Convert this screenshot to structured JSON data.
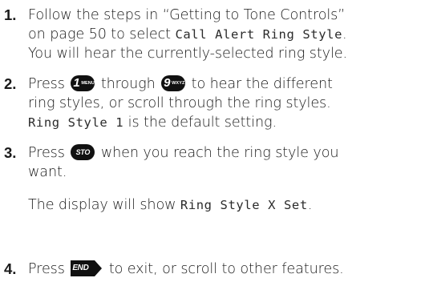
{
  "steps": [
    {
      "number": "1.",
      "line1": "Follow the steps in “Getting to Tone Controls”",
      "line2_pre": "on page 50 to select ",
      "line2_lcd": "Call Alert Ring Style",
      "line2_post": ".",
      "line3": "You will hear the currently-selected ring style."
    },
    {
      "number": "2.",
      "line1_pre": "Press",
      "key1_main": "1",
      "key1_sub": "MENU",
      "line1_mid": "through",
      "key2_main": "9",
      "key2_sub": "WXYZ",
      "line1_post": "to hear the different",
      "line2": "ring styles, or scroll through the ring styles.",
      "line3_lcd": "Ring Style 1",
      "line3_post": " is the default setting."
    },
    {
      "number": "3.",
      "line1_pre": "Press",
      "key_label": "STO",
      "line1_post": "when you reach the ring style you",
      "line2": "want.",
      "display_pre": "The display will show ",
      "display_lcd": "Ring Style X Set",
      "display_post": "."
    },
    {
      "number": "4.",
      "line1_pre": "Press",
      "key_label": "END",
      "line1_post": "to exit, or scroll to other features."
    }
  ]
}
